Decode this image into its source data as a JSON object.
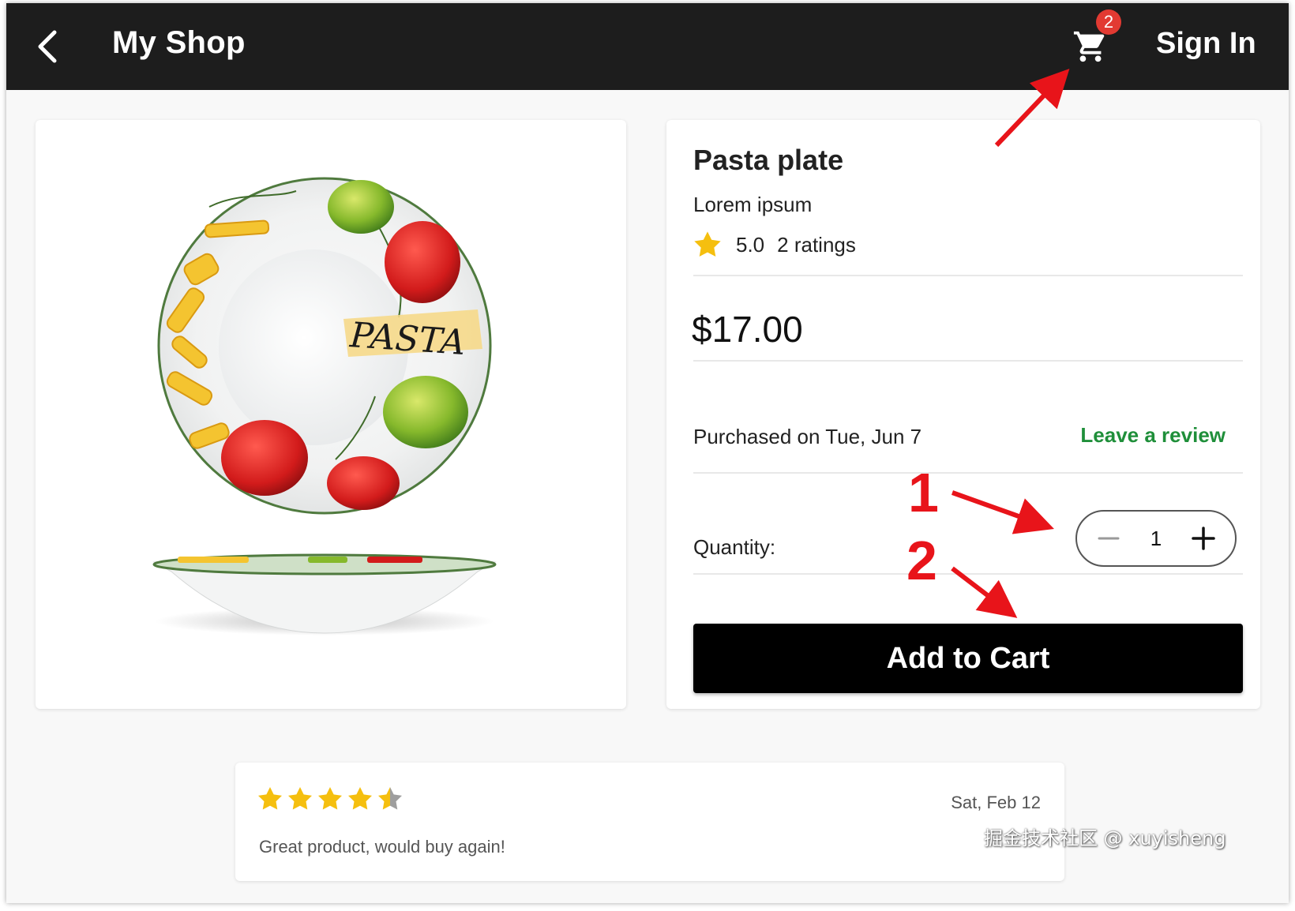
{
  "appbar": {
    "title": "My Shop",
    "cart_badge": "2",
    "signin_label": "Sign In"
  },
  "product": {
    "name": "Pasta plate",
    "subtitle": "Lorem ipsum",
    "rating": "5.0",
    "rating_count": "2 ratings",
    "price": "$17.00",
    "purchased": "Purchased on Tue, Jun 7",
    "review_link": "Leave a review",
    "quantity_label": "Quantity:",
    "quantity": "1",
    "add_to_cart": "Add to Cart",
    "plate_text": "PASTA"
  },
  "review": {
    "stars": 4.5,
    "date": "Sat, Feb 12",
    "text": "Great product, would buy again!"
  },
  "annotations": {
    "step1": "1",
    "step2": "2"
  },
  "watermark": "掘金技术社区 @ xuyisheng",
  "colors": {
    "appbar": "#1d1d1d",
    "badge": "#e23a32",
    "link_green": "#1f8f3a",
    "star": "#f5bf0f",
    "annotation_red": "#e8141a"
  }
}
